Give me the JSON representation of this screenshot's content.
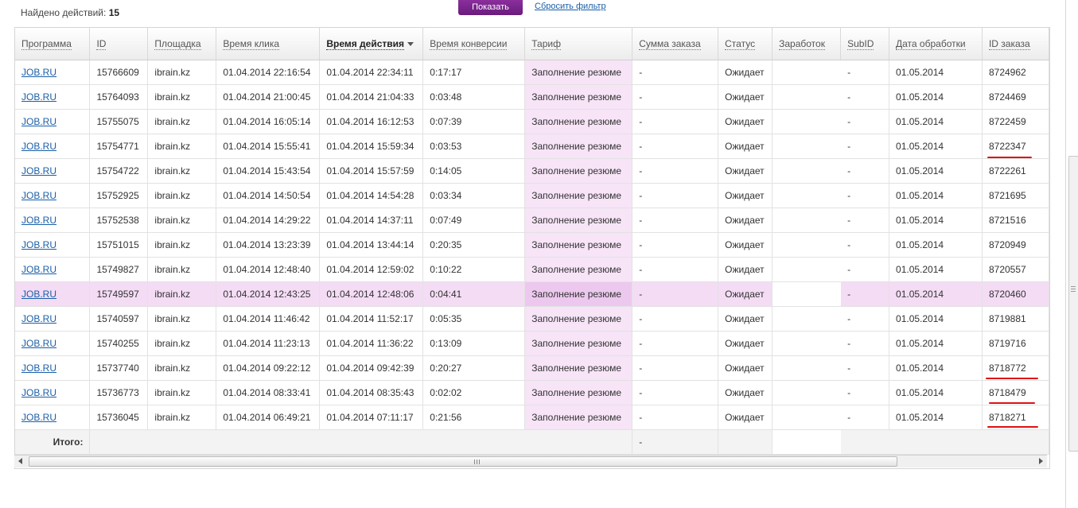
{
  "header": {
    "found_label": "Найдено действий:",
    "found_count": "15",
    "show_button": "Показать",
    "reset_link": "Сбросить фильтр"
  },
  "table": {
    "columns": [
      "Программа",
      "ID",
      "Площадка",
      "Время клика",
      "Время действия",
      "Время конверсии",
      "Тариф",
      "Сумма заказа",
      "Статус",
      "Заработок",
      "SubID",
      "Дата обработки",
      "ID заказа"
    ],
    "rows": [
      [
        "JOB.RU",
        "15766609",
        "ibrain.kz",
        "01.04.2014 22:16:54",
        "01.04.2014 22:34:11",
        "0:17:17",
        "Заполнение резюме",
        "-",
        "Ожидает",
        "",
        "-",
        "01.05.2014",
        "8724962"
      ],
      [
        "JOB.RU",
        "15764093",
        "ibrain.kz",
        "01.04.2014 21:00:45",
        "01.04.2014 21:04:33",
        "0:03:48",
        "Заполнение резюме",
        "-",
        "Ожидает",
        "",
        "-",
        "01.05.2014",
        "8724469"
      ],
      [
        "JOB.RU",
        "15755075",
        "ibrain.kz",
        "01.04.2014 16:05:14",
        "01.04.2014 16:12:53",
        "0:07:39",
        "Заполнение резюме",
        "-",
        "Ожидает",
        "",
        "-",
        "01.05.2014",
        "8722459"
      ],
      [
        "JOB.RU",
        "15754771",
        "ibrain.kz",
        "01.04.2014 15:55:41",
        "01.04.2014 15:59:34",
        "0:03:53",
        "Заполнение резюме",
        "-",
        "Ожидает",
        "",
        "-",
        "01.05.2014",
        "8722347"
      ],
      [
        "JOB.RU",
        "15754722",
        "ibrain.kz",
        "01.04.2014 15:43:54",
        "01.04.2014 15:57:59",
        "0:14:05",
        "Заполнение резюме",
        "-",
        "Ожидает",
        "",
        "-",
        "01.05.2014",
        "8722261"
      ],
      [
        "JOB.RU",
        "15752925",
        "ibrain.kz",
        "01.04.2014 14:50:54",
        "01.04.2014 14:54:28",
        "0:03:34",
        "Заполнение резюме",
        "-",
        "Ожидает",
        "",
        "-",
        "01.05.2014",
        "8721695"
      ],
      [
        "JOB.RU",
        "15752538",
        "ibrain.kz",
        "01.04.2014 14:29:22",
        "01.04.2014 14:37:11",
        "0:07:49",
        "Заполнение резюме",
        "-",
        "Ожидает",
        "",
        "-",
        "01.05.2014",
        "8721516"
      ],
      [
        "JOB.RU",
        "15751015",
        "ibrain.kz",
        "01.04.2014 13:23:39",
        "01.04.2014 13:44:14",
        "0:20:35",
        "Заполнение резюме",
        "-",
        "Ожидает",
        "",
        "-",
        "01.05.2014",
        "8720949"
      ],
      [
        "JOB.RU",
        "15749827",
        "ibrain.kz",
        "01.04.2014 12:48:40",
        "01.04.2014 12:59:02",
        "0:10:22",
        "Заполнение резюме",
        "-",
        "Ожидает",
        "",
        "-",
        "01.05.2014",
        "8720557"
      ],
      [
        "JOB.RU",
        "15749597",
        "ibrain.kz",
        "01.04.2014 12:43:25",
        "01.04.2014 12:48:06",
        "0:04:41",
        "Заполнение резюме",
        "-",
        "Ожидает",
        "",
        "-",
        "01.05.2014",
        "8720460"
      ],
      [
        "JOB.RU",
        "15740597",
        "ibrain.kz",
        "01.04.2014 11:46:42",
        "01.04.2014 11:52:17",
        "0:05:35",
        "Заполнение резюме",
        "-",
        "Ожидает",
        "",
        "-",
        "01.05.2014",
        "8719881"
      ],
      [
        "JOB.RU",
        "15740255",
        "ibrain.kz",
        "01.04.2014 11:23:13",
        "01.04.2014 11:36:22",
        "0:13:09",
        "Заполнение резюме",
        "-",
        "Ожидает",
        "",
        "-",
        "01.05.2014",
        "8719716"
      ],
      [
        "JOB.RU",
        "15737740",
        "ibrain.kz",
        "01.04.2014 09:22:12",
        "01.04.2014 09:42:39",
        "0:20:27",
        "Заполнение резюме",
        "-",
        "Ожидает",
        "",
        "-",
        "01.05.2014",
        "8718772"
      ],
      [
        "JOB.RU",
        "15736773",
        "ibrain.kz",
        "01.04.2014 08:33:41",
        "01.04.2014 08:35:43",
        "0:02:02",
        "Заполнение резюме",
        "-",
        "Ожидает",
        "",
        "-",
        "01.05.2014",
        "8718479"
      ],
      [
        "JOB.RU",
        "15736045",
        "ibrain.kz",
        "01.04.2014 06:49:21",
        "01.04.2014 07:11:17",
        "0:21:56",
        "Заполнение резюме",
        "-",
        "Ожидает",
        "",
        "-",
        "01.05.2014",
        "8718271"
      ]
    ],
    "highlighted_row": 9,
    "total_label": "Итого:",
    "total_sum": "-"
  },
  "colors": {
    "accent": "#6a1b7d",
    "tariff_bg": "#f7e4f7",
    "highlight_bg": "#f4dcf5",
    "link": "#1a5fa8",
    "marker": "#e01010"
  }
}
